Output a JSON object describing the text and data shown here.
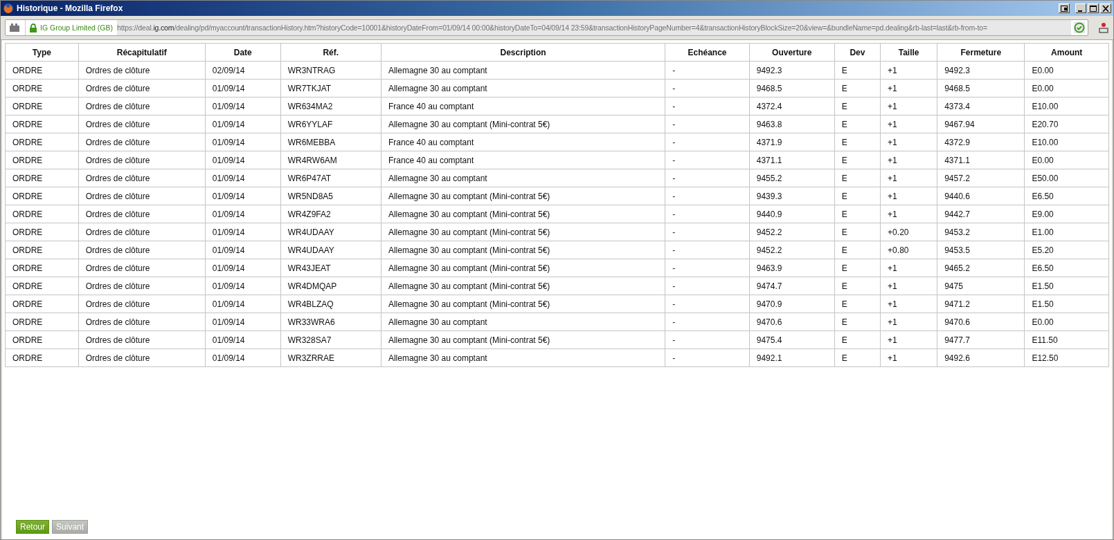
{
  "window": {
    "title": "Historique - Mozilla Firefox"
  },
  "address_bar": {
    "site_identity": "IG Group Limited (GB)",
    "url": "https://deal.**ig.com**/dealing/pd/myaccount/transactionHistory.htm?historyCode=10001&historyDateFrom=01/09/14 00:00&historyDateTo=04/09/14 23:59&transactionHistoryPageNumber=4&transactionHistoryBlockSize=20&view=&bundleName=pd.dealing&rb-last=last&rb-from-to="
  },
  "table": {
    "columns": [
      "Type",
      "Récapitulatif",
      "Date",
      "Réf.",
      "Description",
      "Echéance",
      "Ouverture",
      "Dev",
      "Taille",
      "Fermeture",
      "Amount"
    ],
    "rows": [
      [
        "ORDRE",
        "Ordres de clôture",
        "02/09/14",
        "WR3NTRAG",
        "Allemagne 30 au comptant",
        "-",
        "9492.3",
        "E",
        "+1",
        "9492.3",
        "E0.00"
      ],
      [
        "ORDRE",
        "Ordres de clôture",
        "01/09/14",
        "WR7TKJAT",
        "Allemagne 30 au comptant",
        "-",
        "9468.5",
        "E",
        "+1",
        "9468.5",
        "E0.00"
      ],
      [
        "ORDRE",
        "Ordres de clôture",
        "01/09/14",
        "WR634MA2",
        "France 40 au comptant",
        "-",
        "4372.4",
        "E",
        "+1",
        "4373.4",
        "E10.00"
      ],
      [
        "ORDRE",
        "Ordres de clôture",
        "01/09/14",
        "WR6YYLAF",
        "Allemagne 30 au comptant (Mini-contrat 5€)",
        "-",
        "9463.8",
        "E",
        "+1",
        "9467.94",
        "E20.70"
      ],
      [
        "ORDRE",
        "Ordres de clôture",
        "01/09/14",
        "WR6MEBBA",
        "France 40 au comptant",
        "-",
        "4371.9",
        "E",
        "+1",
        "4372.9",
        "E10.00"
      ],
      [
        "ORDRE",
        "Ordres de clôture",
        "01/09/14",
        "WR4RW6AM",
        "France 40 au comptant",
        "-",
        "4371.1",
        "E",
        "+1",
        "4371.1",
        "E0.00"
      ],
      [
        "ORDRE",
        "Ordres de clôture",
        "01/09/14",
        "WR6P47AT",
        "Allemagne 30 au comptant",
        "-",
        "9455.2",
        "E",
        "+1",
        "9457.2",
        "E50.00"
      ],
      [
        "ORDRE",
        "Ordres de clôture",
        "01/09/14",
        "WR5ND8A5",
        "Allemagne 30 au comptant (Mini-contrat 5€)",
        "-",
        "9439.3",
        "E",
        "+1",
        "9440.6",
        "E6.50"
      ],
      [
        "ORDRE",
        "Ordres de clôture",
        "01/09/14",
        "WR4Z9FA2",
        "Allemagne 30 au comptant (Mini-contrat 5€)",
        "-",
        "9440.9",
        "E",
        "+1",
        "9442.7",
        "E9.00"
      ],
      [
        "ORDRE",
        "Ordres de clôture",
        "01/09/14",
        "WR4UDAAY",
        "Allemagne 30 au comptant (Mini-contrat 5€)",
        "-",
        "9452.2",
        "E",
        "+0.20",
        "9453.2",
        "E1.00"
      ],
      [
        "ORDRE",
        "Ordres de clôture",
        "01/09/14",
        "WR4UDAAY",
        "Allemagne 30 au comptant (Mini-contrat 5€)",
        "-",
        "9452.2",
        "E",
        "+0.80",
        "9453.5",
        "E5.20"
      ],
      [
        "ORDRE",
        "Ordres de clôture",
        "01/09/14",
        "WR43JEAT",
        "Allemagne 30 au comptant (Mini-contrat 5€)",
        "-",
        "9463.9",
        "E",
        "+1",
        "9465.2",
        "E6.50"
      ],
      [
        "ORDRE",
        "Ordres de clôture",
        "01/09/14",
        "WR4DMQAP",
        "Allemagne 30 au comptant (Mini-contrat 5€)",
        "-",
        "9474.7",
        "E",
        "+1",
        "9475",
        "E1.50"
      ],
      [
        "ORDRE",
        "Ordres de clôture",
        "01/09/14",
        "WR4BLZAQ",
        "Allemagne 30 au comptant (Mini-contrat 5€)",
        "-",
        "9470.9",
        "E",
        "+1",
        "9471.2",
        "E1.50"
      ],
      [
        "ORDRE",
        "Ordres de clôture",
        "01/09/14",
        "WR33WRA6",
        "Allemagne 30 au comptant",
        "-",
        "9470.6",
        "E",
        "+1",
        "9470.6",
        "E0.00"
      ],
      [
        "ORDRE",
        "Ordres de clôture",
        "01/09/14",
        "WR328SA7",
        "Allemagne 30 au comptant (Mini-contrat 5€)",
        "-",
        "9475.4",
        "E",
        "+1",
        "9477.7",
        "E11.50"
      ],
      [
        "ORDRE",
        "Ordres de clôture",
        "01/09/14",
        "WR3ZRRAE",
        "Allemagne 30 au comptant",
        "-",
        "9492.1",
        "E",
        "+1",
        "9492.6",
        "E12.50"
      ]
    ]
  },
  "buttons": [
    {
      "label": "Retour",
      "disabled": false
    },
    {
      "label": "Suivant",
      "disabled": true
    }
  ]
}
